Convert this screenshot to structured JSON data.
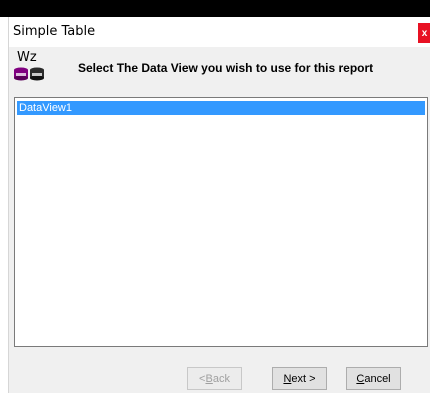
{
  "window": {
    "title": "Simple Table",
    "close_glyph": "x"
  },
  "header": {
    "icon_letters": "Wz",
    "icon_name": "wizard-database-icon",
    "text": "Select The Data View you wish to use for this report"
  },
  "list": {
    "items": [
      {
        "label": "DataView1",
        "selected": true
      }
    ]
  },
  "buttons": {
    "back": {
      "mnemonic": "B",
      "rest": "ack",
      "prefix": "< ",
      "enabled": false
    },
    "next": {
      "mnemonic": "N",
      "rest": "ext >",
      "enabled": true
    },
    "cancel": {
      "mnemonic": "C",
      "rest": "ancel",
      "enabled": true
    }
  },
  "colors": {
    "close": "#e81123",
    "selection": "#3399ff",
    "dialog_bg": "#f0f0f0",
    "db_left": "#800080",
    "db_right": "#2b2b2b"
  }
}
